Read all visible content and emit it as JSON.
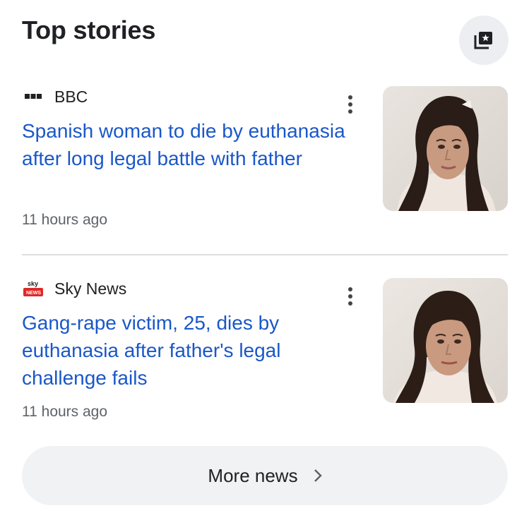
{
  "header": {
    "title": "Top stories",
    "save_icon": "bookmark-star-icon"
  },
  "stories": [
    {
      "source": "BBC",
      "source_icon": "bbc-logo-icon",
      "headline": "Spanish woman to die by euthanasia after long legal battle with father",
      "time": "11 hours ago",
      "menu_icon": "more-vert-icon",
      "thumbnail": "woman-portrait-image"
    },
    {
      "source": "Sky News",
      "source_icon": "sky-news-logo-icon",
      "headline": "Gang-rape victim, 25, dies by euthanasia after father's legal challenge fails",
      "time": "11 hours ago",
      "menu_icon": "more-vert-icon",
      "thumbnail": "woman-portrait-image"
    }
  ],
  "footer": {
    "more_news_label": "More news",
    "chevron_icon": "chevron-right-icon"
  },
  "colors": {
    "headline": "#1a57c8",
    "text": "#202124",
    "secondary": "#5f6368",
    "button_bg": "#f1f2f4"
  }
}
